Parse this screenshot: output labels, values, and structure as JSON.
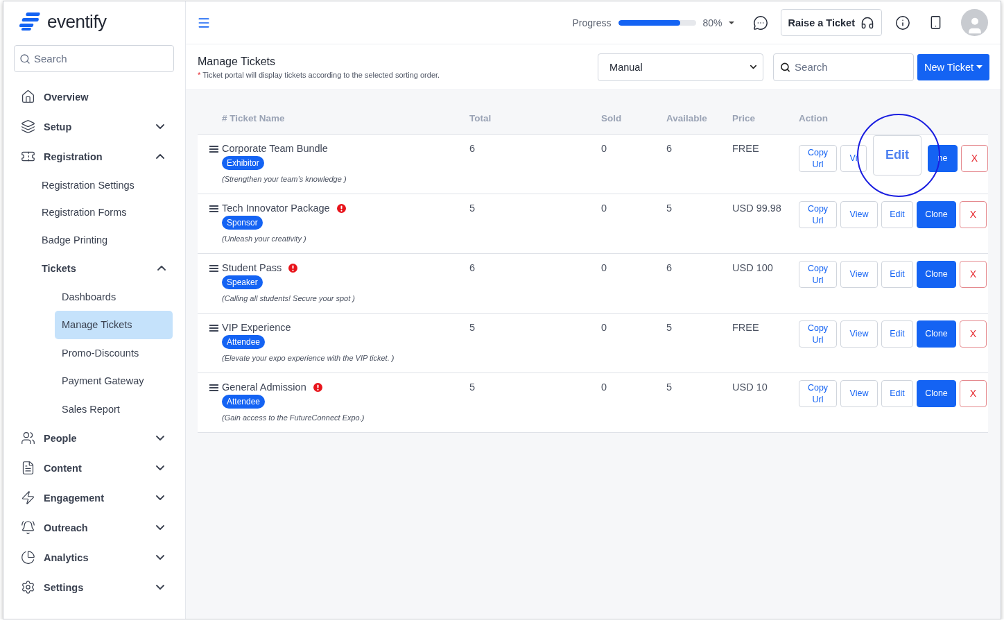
{
  "brand": {
    "name": "eventify"
  },
  "sidebar": {
    "search": {
      "placeholder": "Search"
    },
    "items": [
      {
        "label": "Overview",
        "selected": false
      },
      {
        "label": "Setup",
        "selected": false,
        "expanded": false
      },
      {
        "label": "Registration",
        "selected": false,
        "expanded": true,
        "children": [
          {
            "label": "Registration Settings",
            "selected": false
          },
          {
            "label": "Registration Forms",
            "selected": false
          },
          {
            "label": "Badge Printing",
            "selected": false
          },
          {
            "label": "Tickets",
            "selected": false,
            "expanded": true,
            "children": [
              {
                "label": "Dashboards",
                "selected": false
              },
              {
                "label": "Manage Tickets",
                "selected": true
              },
              {
                "label": "Promo-Discounts",
                "selected": false
              },
              {
                "label": "Payment Gateway",
                "selected": false
              },
              {
                "label": "Sales Report",
                "selected": false
              }
            ]
          }
        ]
      },
      {
        "label": "People",
        "selected": false,
        "expanded": false
      },
      {
        "label": "Content",
        "selected": false,
        "expanded": false
      },
      {
        "label": "Engagement",
        "selected": false,
        "expanded": false
      },
      {
        "label": "Outreach",
        "selected": false,
        "expanded": false
      },
      {
        "label": "Analytics",
        "selected": false,
        "expanded": false
      },
      {
        "label": "Settings",
        "selected": false,
        "expanded": false
      }
    ]
  },
  "topbar": {
    "progress": {
      "label": "Progress",
      "level": 0.8,
      "reading": "80%"
    },
    "raise_ticket": "Raise a Ticket"
  },
  "page": {
    "title": "Manage Tickets",
    "note_mark": "*",
    "note": "Ticket portal will display tickets according to the selected sorting order.",
    "sort": {
      "value": "Manual"
    },
    "search": {
      "placeholder": "Search"
    },
    "new_button": "New Ticket"
  },
  "table": {
    "columns": [
      "# Ticket Name",
      "Total",
      "Sold",
      "Available",
      "Price",
      "Action"
    ],
    "rows": [
      {
        "name": "Corporate Team Bundle",
        "warning": false,
        "tag": "Exhibitor",
        "description": "(Strengthen your team’s knowledge )",
        "total": "6",
        "sold": "0",
        "available": "6",
        "price": "FREE",
        "magnified": true,
        "actions": [
          {
            "label": "Copy Url",
            "kind": "outline"
          },
          {
            "label": "Vi",
            "kind": "outline"
          },
          {
            "label": "Edit",
            "kind": "zoomed"
          },
          {
            "label": "ne",
            "kind": "primary"
          },
          {
            "label": "X",
            "kind": "danger"
          }
        ]
      },
      {
        "name": "Tech Innovator Package",
        "warning": true,
        "tag": "Sponsor",
        "description": "(Unleash your creativity )",
        "total": "5",
        "sold": "0",
        "available": "5",
        "price": "USD 99.98",
        "actions": [
          {
            "label": "Copy Url",
            "kind": "outline"
          },
          {
            "label": "View",
            "kind": "outline"
          },
          {
            "label": "Edit",
            "kind": "outline"
          },
          {
            "label": "Clone",
            "kind": "primary"
          },
          {
            "label": "X",
            "kind": "danger"
          }
        ]
      },
      {
        "name": "Student Pass",
        "warning": true,
        "tag": "Speaker",
        "description": "(Calling all students! Secure your spot )",
        "total": "6",
        "sold": "0",
        "available": "6",
        "price": "USD 100",
        "actions": [
          {
            "label": "Copy Url",
            "kind": "outline"
          },
          {
            "label": "View",
            "kind": "outline"
          },
          {
            "label": "Edit",
            "kind": "outline"
          },
          {
            "label": "Clone",
            "kind": "primary"
          },
          {
            "label": "X",
            "kind": "danger"
          }
        ]
      },
      {
        "name": "VIP Experience",
        "warning": false,
        "tag": "Attendee",
        "description": "(Elevate your expo experience with the VIP ticket. )",
        "total": "5",
        "sold": "0",
        "available": "5",
        "price": "FREE",
        "actions": [
          {
            "label": "Copy Url",
            "kind": "outline"
          },
          {
            "label": "View",
            "kind": "outline"
          },
          {
            "label": "Edit",
            "kind": "outline"
          },
          {
            "label": "Clone",
            "kind": "primary"
          },
          {
            "label": "X",
            "kind": "danger"
          }
        ]
      },
      {
        "name": "General Admission",
        "warning": true,
        "tag": "Attendee",
        "description": "(Gain access to the FutureConnect Expo.)",
        "total": "5",
        "sold": "0",
        "available": "5",
        "price": "USD 10",
        "actions": [
          {
            "label": "Copy Url",
            "kind": "outline"
          },
          {
            "label": "View",
            "kind": "outline"
          },
          {
            "label": "Edit",
            "kind": "outline"
          },
          {
            "label": "Clone",
            "kind": "primary"
          },
          {
            "label": "X",
            "kind": "danger"
          }
        ]
      }
    ]
  }
}
